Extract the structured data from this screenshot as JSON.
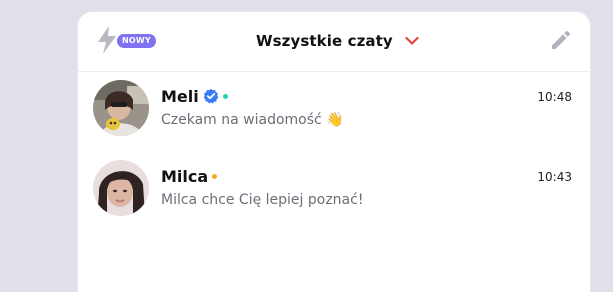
{
  "header": {
    "badge_label": "NOWY",
    "title": "Wszystkie czaty"
  },
  "chats": [
    {
      "name": "Meli",
      "verified": true,
      "status_color": "#22d3b8",
      "preview": "Czekam na wiadomość",
      "preview_emoji": "👋",
      "time": "10:48"
    },
    {
      "name": "Milca",
      "verified": false,
      "status_color": "#f5a623",
      "preview": "Milca chce Cię lepiej poznać!",
      "time": "10:43"
    }
  ],
  "icons": {
    "bolt": "lightning-bolt-icon",
    "chevron": "chevron-down-icon",
    "edit": "pencil-icon",
    "verified": "verified-badge-icon"
  },
  "colors": {
    "accent": "#7f72f0",
    "chevron": "#e0463a",
    "verified": "#3b7cf5",
    "background": "#dfe0ea"
  }
}
